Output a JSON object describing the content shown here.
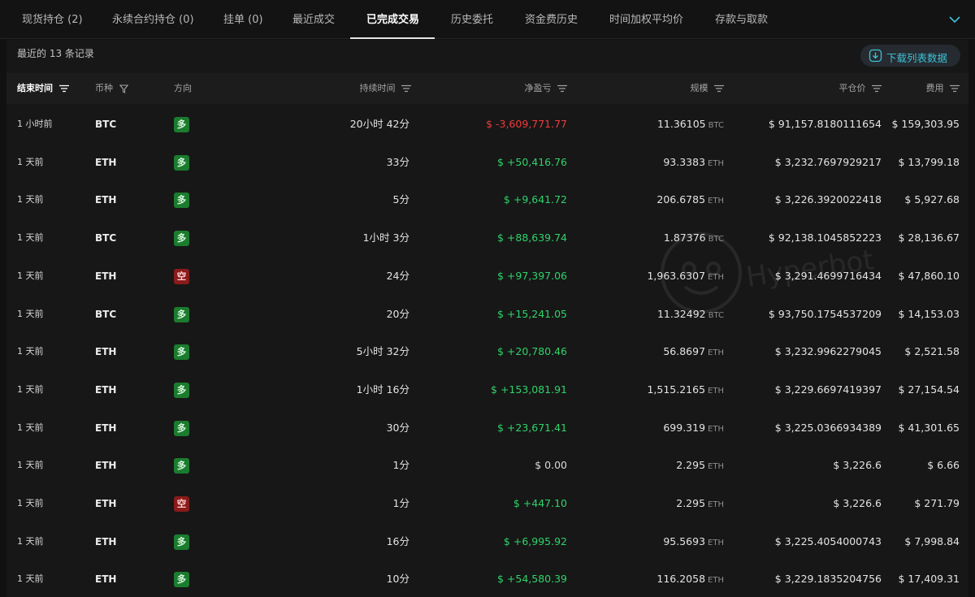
{
  "tabs": [
    {
      "label": "现货持仓 (2)"
    },
    {
      "label": "永续合约持仓 (0)"
    },
    {
      "label": "挂单 (0)"
    },
    {
      "label": "最近成交"
    },
    {
      "label": "已完成交易"
    },
    {
      "label": "历史委托"
    },
    {
      "label": "资金费历史"
    },
    {
      "label": "时间加权平均价"
    },
    {
      "label": "存款与取款"
    }
  ],
  "active_tab": "已完成交易",
  "records_text": "最近的 13 条记录",
  "download_label": "下载列表数据",
  "watermark_text": "Hyperbot",
  "columns": {
    "end_time": "结束时间",
    "coin": "币种",
    "direction": "方向",
    "duration": "持续时间",
    "pnl": "净盈亏",
    "size": "规模",
    "close_price": "平仓价",
    "fee": "费用"
  },
  "colors": {
    "positive": "#2fd36b",
    "negative": "#f03a3a",
    "accent": "#3fc1d8",
    "long_badge": "#1b7c2e",
    "short_badge": "#8a1b1b"
  },
  "rows": [
    {
      "end_time": "1 小时前",
      "coin": "BTC",
      "direction": "多",
      "duration": "20小时 42分",
      "pnl": "$ -3,609,771.77",
      "pnl_sign": "neg",
      "size": "11.36105",
      "unit": "BTC",
      "close_price": "$ 91,157.8180111654",
      "fee": "$ 159,303.95"
    },
    {
      "end_time": "1 天前",
      "coin": "ETH",
      "direction": "多",
      "duration": "33分",
      "pnl": "$ +50,416.76",
      "pnl_sign": "pos",
      "size": "93.3383",
      "unit": "ETH",
      "close_price": "$ 3,232.7697929217",
      "fee": "$ 13,799.18"
    },
    {
      "end_time": "1 天前",
      "coin": "ETH",
      "direction": "多",
      "duration": "5分",
      "pnl": "$ +9,641.72",
      "pnl_sign": "pos",
      "size": "206.6785",
      "unit": "ETH",
      "close_price": "$ 3,226.3920022418",
      "fee": "$ 5,927.68"
    },
    {
      "end_time": "1 天前",
      "coin": "BTC",
      "direction": "多",
      "duration": "1小时 3分",
      "pnl": "$ +88,639.74",
      "pnl_sign": "pos",
      "size": "1.87376",
      "unit": "BTC",
      "close_price": "$ 92,138.1045852223",
      "fee": "$ 28,136.67"
    },
    {
      "end_time": "1 天前",
      "coin": "ETH",
      "direction": "空",
      "duration": "24分",
      "pnl": "$ +97,397.06",
      "pnl_sign": "pos",
      "size": "1,963.6307",
      "unit": "ETH",
      "close_price": "$ 3,291.4699716434",
      "fee": "$ 47,860.10"
    },
    {
      "end_time": "1 天前",
      "coin": "BTC",
      "direction": "多",
      "duration": "20分",
      "pnl": "$ +15,241.05",
      "pnl_sign": "pos",
      "size": "11.32492",
      "unit": "BTC",
      "close_price": "$ 93,750.1754537209",
      "fee": "$ 14,153.03"
    },
    {
      "end_time": "1 天前",
      "coin": "ETH",
      "direction": "多",
      "duration": "5小时 32分",
      "pnl": "$ +20,780.46",
      "pnl_sign": "pos",
      "size": "56.8697",
      "unit": "ETH",
      "close_price": "$ 3,232.9962279045",
      "fee": "$ 2,521.58"
    },
    {
      "end_time": "1 天前",
      "coin": "ETH",
      "direction": "多",
      "duration": "1小时 16分",
      "pnl": "$ +153,081.91",
      "pnl_sign": "pos",
      "size": "1,515.2165",
      "unit": "ETH",
      "close_price": "$ 3,229.6697419397",
      "fee": "$ 27,154.54"
    },
    {
      "end_time": "1 天前",
      "coin": "ETH",
      "direction": "多",
      "duration": "30分",
      "pnl": "$ +23,671.41",
      "pnl_sign": "pos",
      "size": "699.319",
      "unit": "ETH",
      "close_price": "$ 3,225.0366934389",
      "fee": "$ 41,301.65"
    },
    {
      "end_time": "1 天前",
      "coin": "ETH",
      "direction": "多",
      "duration": "1分",
      "pnl": "$ 0.00",
      "pnl_sign": "zero",
      "size": "2.295",
      "unit": "ETH",
      "close_price": "$ 3,226.6",
      "fee": "$ 6.66"
    },
    {
      "end_time": "1 天前",
      "coin": "ETH",
      "direction": "空",
      "duration": "1分",
      "pnl": "$ +447.10",
      "pnl_sign": "pos",
      "size": "2.295",
      "unit": "ETH",
      "close_price": "$ 3,226.6",
      "fee": "$ 271.79"
    },
    {
      "end_time": "1 天前",
      "coin": "ETH",
      "direction": "多",
      "duration": "16分",
      "pnl": "$ +6,995.92",
      "pnl_sign": "pos",
      "size": "95.5693",
      "unit": "ETH",
      "close_price": "$ 3,225.4054000743",
      "fee": "$ 7,998.84"
    },
    {
      "end_time": "1 天前",
      "coin": "ETH",
      "direction": "多",
      "duration": "10分",
      "pnl": "$ +54,580.39",
      "pnl_sign": "pos",
      "size": "116.2058",
      "unit": "ETH",
      "close_price": "$ 3,229.1835204756",
      "fee": "$ 17,409.31"
    }
  ]
}
